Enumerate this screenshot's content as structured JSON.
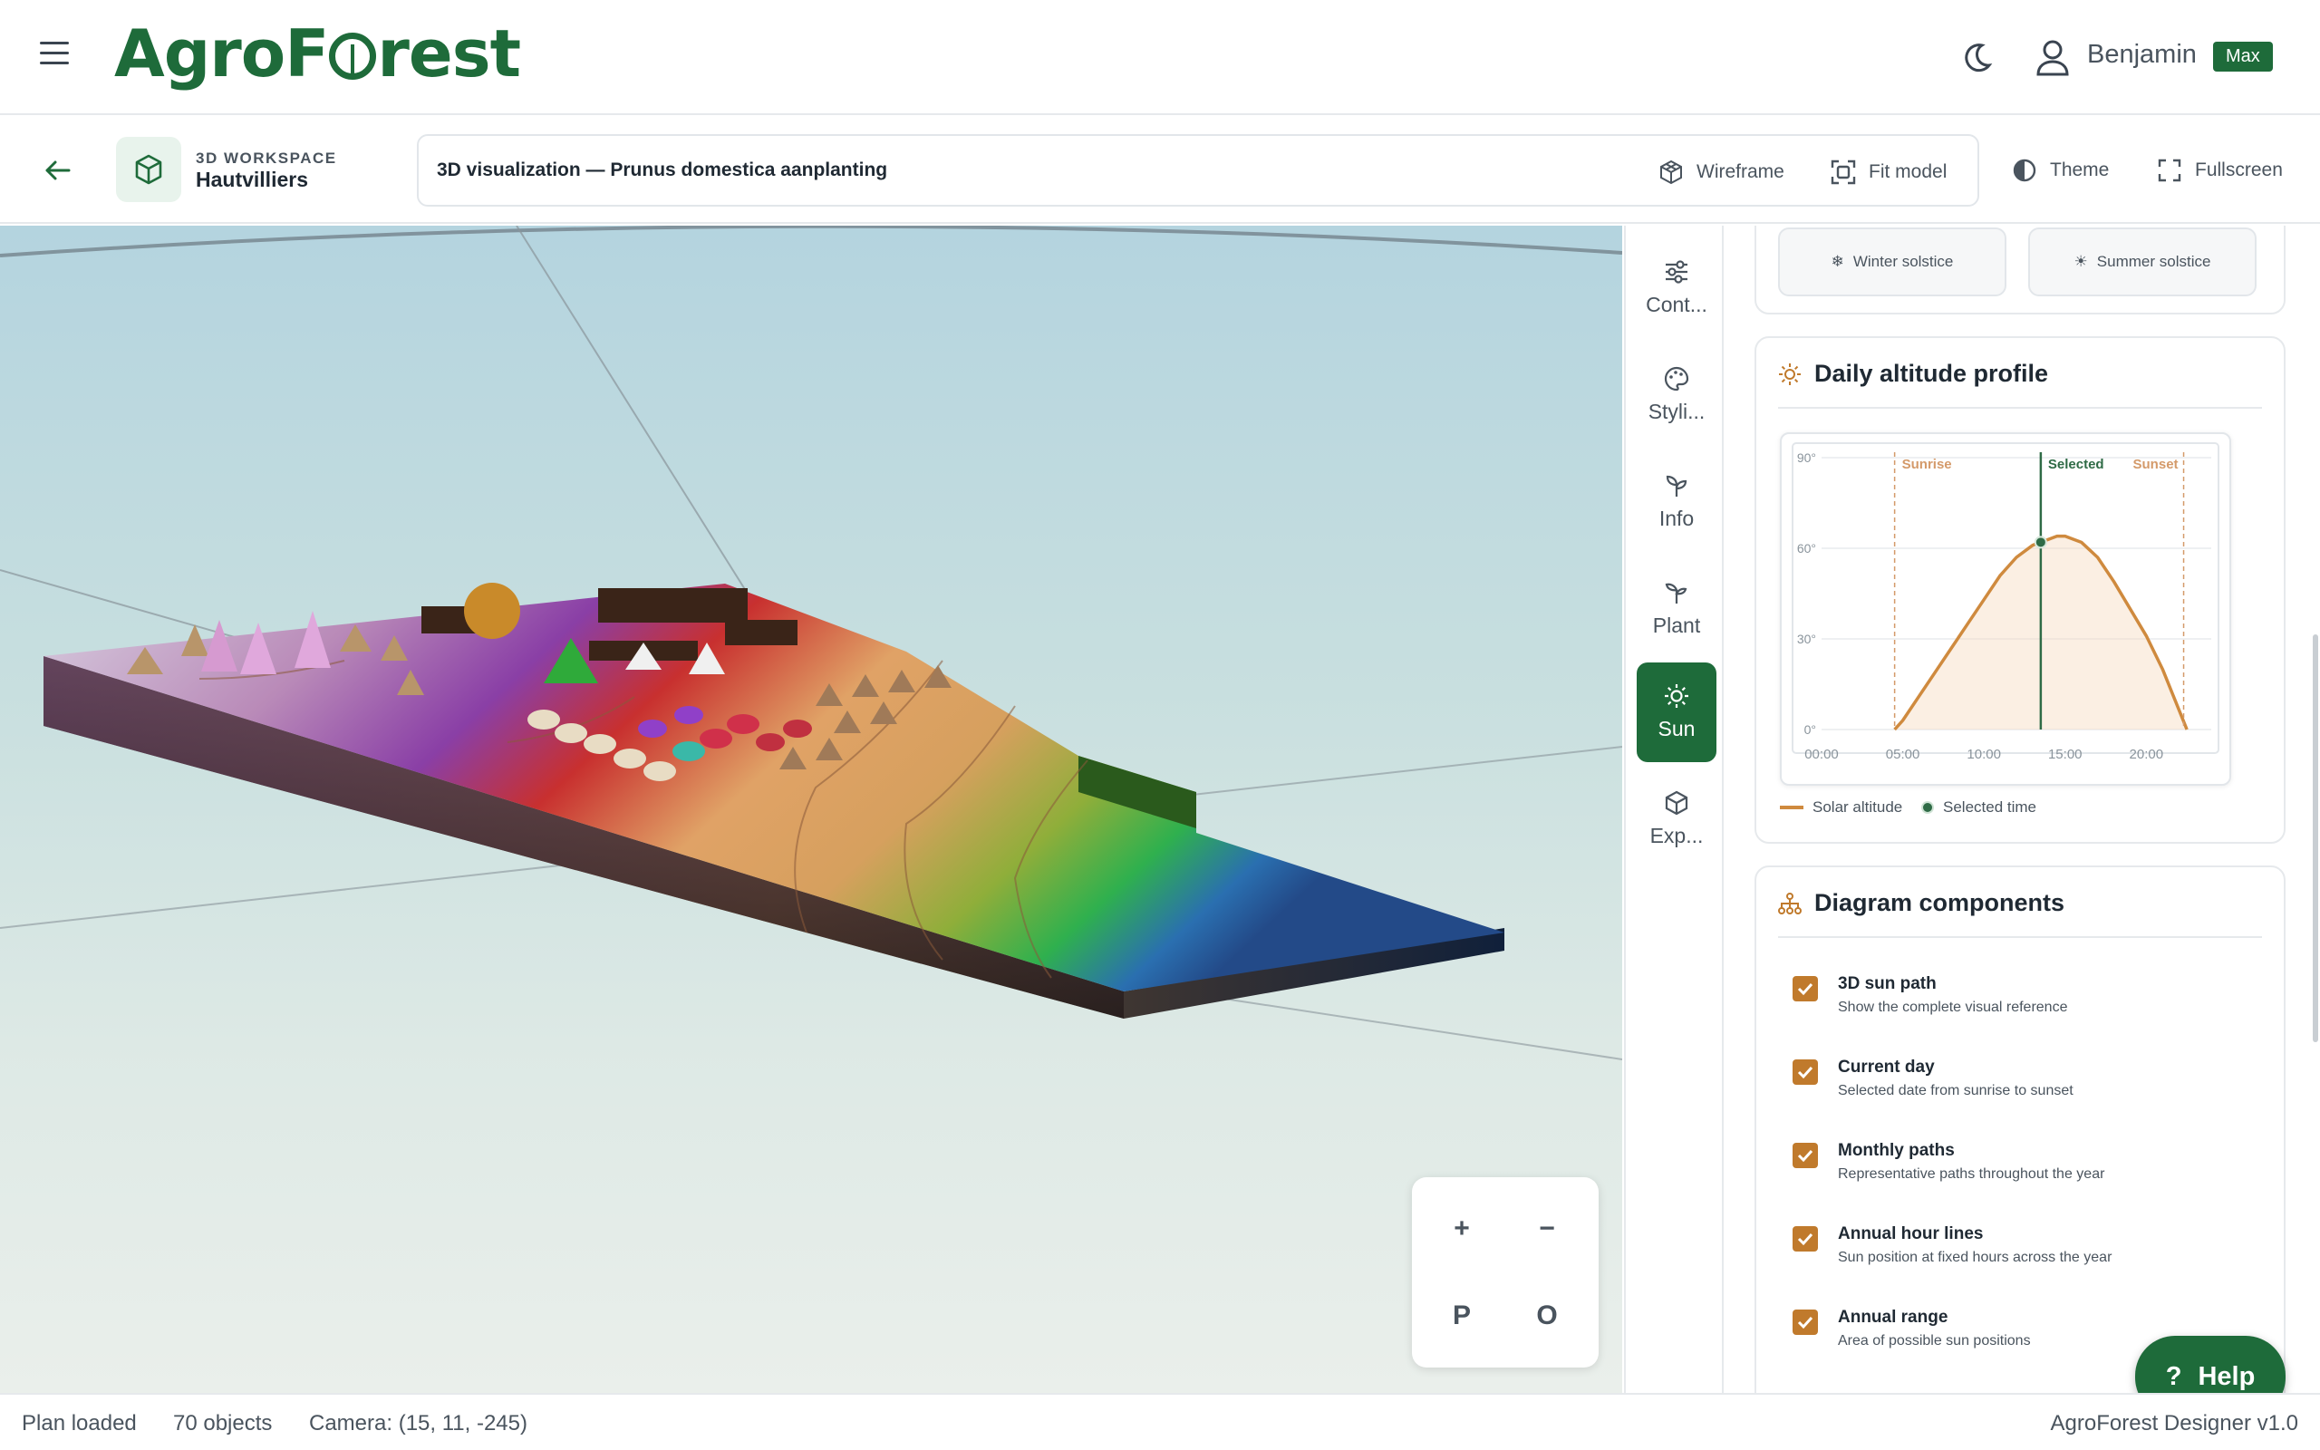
{
  "app": {
    "logo_text_pre": "AgroF",
    "logo_text_post": "rest",
    "user_name": "Benjamin",
    "plan_badge": "Max"
  },
  "toolbar": {
    "kicker": "3D WORKSPACE",
    "workspace_name": "Hautvilliers",
    "title": "3D visualization — Prunus domestica aanplanting",
    "wireframe": "Wireframe",
    "fit_model": "Fit model",
    "theme": "Theme",
    "fullscreen": "Fullscreen"
  },
  "zoom": {
    "plus": "+",
    "minus": "−",
    "perspective": "P",
    "ortho": "O"
  },
  "tabs": [
    {
      "label": "Cont...",
      "icon": "sliders-icon"
    },
    {
      "label": "Styli...",
      "icon": "palette-icon"
    },
    {
      "label": "Info",
      "icon": "sprout-icon"
    },
    {
      "label": "Plant",
      "icon": "plant-icon"
    },
    {
      "label": "Sun",
      "icon": "sun-icon",
      "active": true
    },
    {
      "label": "Exp...",
      "icon": "box-export-icon"
    }
  ],
  "solstice": {
    "winter": "Winter solstice",
    "summer": "Summer solstice"
  },
  "altitude_card": {
    "title": "Daily altitude profile",
    "legend_altitude": "Solar altitude",
    "legend_selected": "Selected time"
  },
  "chart_data": {
    "type": "area",
    "x": [
      "04:30",
      "05:00",
      "06:00",
      "07:00",
      "08:00",
      "09:00",
      "10:00",
      "11:00",
      "12:00",
      "13:00",
      "14:00",
      "14:30",
      "15:00",
      "16:00",
      "17:00",
      "18:00",
      "19:00",
      "20:00",
      "21:00",
      "22:30"
    ],
    "series": [
      {
        "name": "Solar altitude",
        "values": [
          0,
          3,
          11,
          19,
          27,
          35,
          43,
          51,
          57,
          61,
          63,
          64,
          64,
          62,
          57,
          49,
          40,
          31,
          20,
          0
        ]
      }
    ],
    "x_ticks": [
      "00:00",
      "05:00",
      "10:00",
      "15:00",
      "20:00"
    ],
    "y_ticks": [
      "0°",
      "30°",
      "60°",
      "90°"
    ],
    "ylim": [
      0,
      90
    ],
    "xlim_hours": [
      0,
      24
    ],
    "markers": [
      {
        "label": "Sunrise",
        "hour": 4.5
      },
      {
        "label": "Selected",
        "hour": 13.5
      },
      {
        "label": "Sunset",
        "hour": 22.3
      }
    ],
    "selected_point": {
      "hour": 13.5,
      "value": 62
    },
    "colors": {
      "line": "#cf8a3e",
      "fill": "#f7dcc0",
      "selected": "#2f6b46",
      "marker": "#d49a6a"
    },
    "grid": true
  },
  "components_card": {
    "title": "Diagram components",
    "items": [
      {
        "title": "3D sun path",
        "sub": "Show the complete visual reference"
      },
      {
        "title": "Current day",
        "sub": "Selected date from sunrise to sunset"
      },
      {
        "title": "Monthly paths",
        "sub": "Representative paths throughout the year"
      },
      {
        "title": "Annual hour lines",
        "sub": "Sun position at fixed hours across the year"
      },
      {
        "title": "Annual range",
        "sub": "Area of possible sun positions"
      }
    ]
  },
  "help": {
    "label": "Help",
    "glyph": "?"
  },
  "status": {
    "state": "Plan loaded",
    "objects": "70 objects",
    "camera": "Camera: (15, 11, -245)",
    "version": "AgroForest Designer v1.0"
  }
}
